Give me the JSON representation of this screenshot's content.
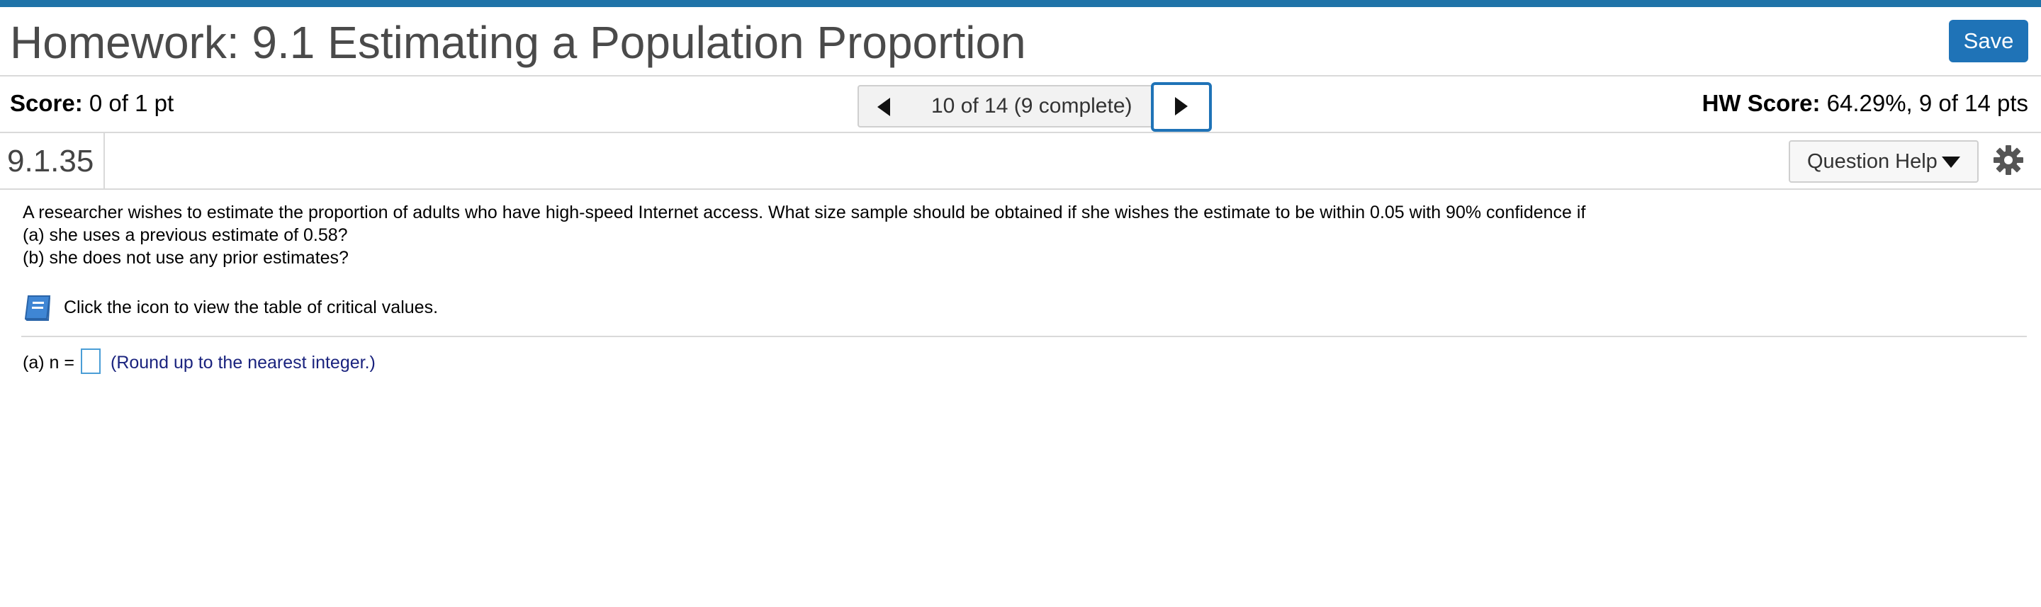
{
  "header": {
    "title": "Homework: 9.1 Estimating a Population Proportion",
    "save_label": "Save",
    "accent_color": "#1f73a8",
    "save_color": "#1f73b7"
  },
  "scorebar": {
    "score_label": "Score:",
    "score_value": "0 of 1 pt",
    "nav_select_value": "10 of 14 (9 complete)",
    "hw_score_label": "HW Score:",
    "hw_score_value": "64.29%, 9 of 14 pts"
  },
  "question_bar": {
    "question_id": "9.1.35",
    "help_label": "Question Help"
  },
  "question": {
    "lines": [
      "A researcher wishes to estimate the proportion of adults who have high-speed Internet access. What size sample should be obtained if she wishes the estimate to be within 0.05 with 90% confidence if",
      "(a) she uses a previous estimate of 0.58?",
      "(b) she does not use any prior estimates?"
    ],
    "table_link_text": "Click the icon to view the table of critical values."
  },
  "answer": {
    "prefix": "(a) n =",
    "value": "",
    "hint": "(Round up to the nearest integer.)",
    "hint_color": "#1a237e"
  },
  "icons": [
    "triangle-left-icon",
    "triangle-right-icon",
    "chevron-down-icon",
    "gear-icon",
    "book-icon"
  ]
}
